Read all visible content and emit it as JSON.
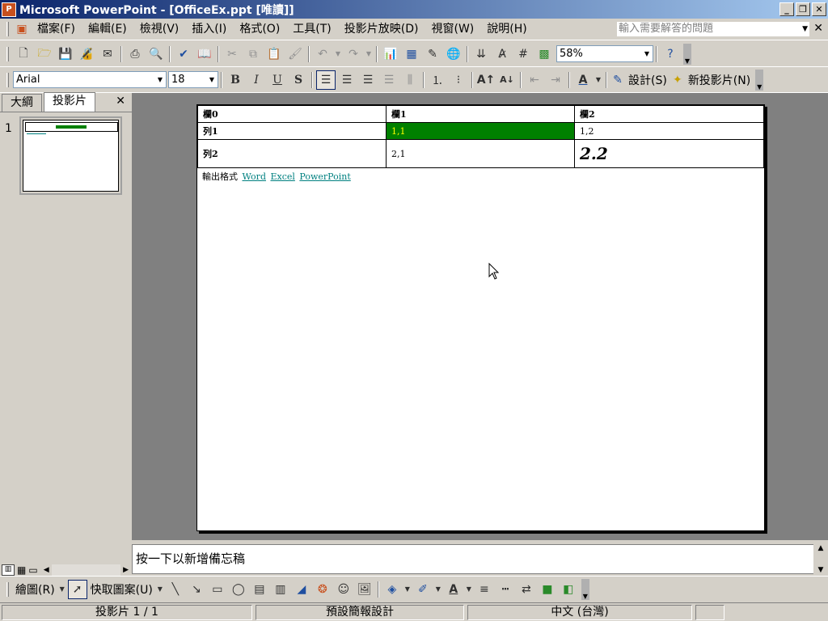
{
  "window": {
    "title": "Microsoft PowerPoint - [OfficeEx.ppt [唯讀]]"
  },
  "menu": {
    "items": [
      "檔案(F)",
      "編輯(E)",
      "檢視(V)",
      "插入(I)",
      "格式(O)",
      "工具(T)",
      "投影片放映(D)",
      "視窗(W)",
      "說明(H)"
    ],
    "help_placeholder": "輸入需要解答的問題"
  },
  "standard_toolbar": {
    "zoom": "58%"
  },
  "format_toolbar": {
    "font": "Arial",
    "size": "18",
    "design_label": "設計(S)",
    "new_slide_label": "新投影片(N)"
  },
  "left_pane": {
    "tabs": [
      "大綱",
      "投影片"
    ],
    "slide_number": "1"
  },
  "slide": {
    "table": {
      "headers": [
        "欄0",
        "欄1",
        "欄2"
      ],
      "rows": [
        [
          "列1",
          "1,1",
          "1,2"
        ],
        [
          "列2",
          "2,1",
          "2.2"
        ]
      ]
    },
    "export_label": "輸出格式",
    "export_links": [
      "Word",
      "Excel",
      "PowerPoint"
    ],
    "highlight_color": "#008000"
  },
  "notes": {
    "placeholder": "按一下以新增備忘稿"
  },
  "draw_toolbar": {
    "draw_label": "繪圖(R)",
    "autoshapes_label": "快取圖案(U)"
  },
  "status": {
    "slide_pos": "投影片 1 / 1",
    "design": "預設簡報設計",
    "language": "中文 (台灣)"
  }
}
